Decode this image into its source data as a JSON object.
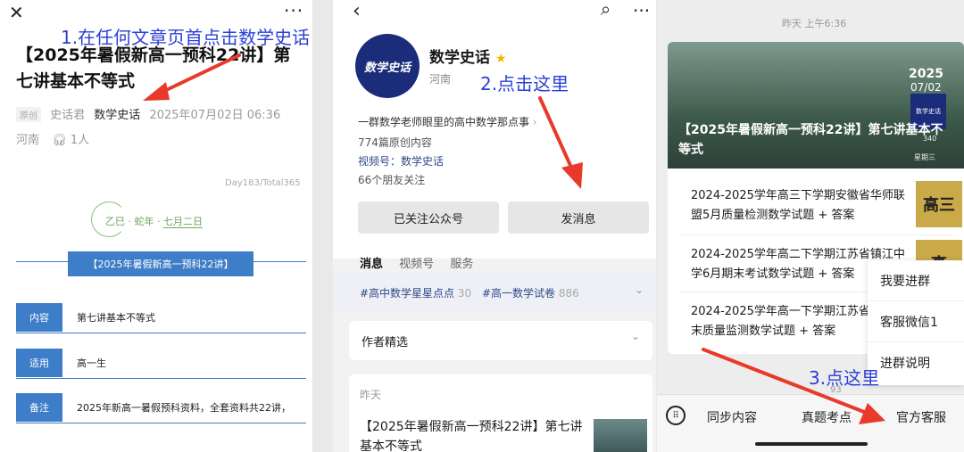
{
  "annotations": {
    "step1": "1.在任何文章页首点击数学史话",
    "step2": "2.点击这里",
    "step3": "3.点这里"
  },
  "panel1": {
    "close_icon": "close-icon",
    "more_icon": "more-dots-icon",
    "title": "【2025年暑假新高一预科22讲】第七讲基本不等式",
    "original_badge": "原创",
    "author": "史话君",
    "account": "数学史话",
    "date": "2025年07月02日 06:36",
    "location": "河南",
    "listen_count": "1人",
    "day_counter": "Day183/Total365",
    "lunar_year": "乙巳",
    "zodiac": "蛇年",
    "lunar_date": "七月二日",
    "banner": "【2025年暑假新高一预科22讲】",
    "rows": [
      {
        "label": "内容",
        "text": "第七讲基本不等式"
      },
      {
        "label": "适用",
        "text": "高一生"
      },
      {
        "label": "备注",
        "text": "2025年新高一暑假预科资料，全套资料共22讲，"
      }
    ]
  },
  "panel2": {
    "avatar_text": "数学史话",
    "name": "数学史话",
    "region": "河南",
    "bio": "一群数学老师眼里的高中数学那点事",
    "original_count": "774篇原创内容",
    "video_label": "视频号：",
    "video_name": "数学史话",
    "friends": "66个朋友关注",
    "followed_btn": "已关注公众号",
    "message_btn": "发消息",
    "tabs": [
      "消息",
      "视频号",
      "服务"
    ],
    "tags": [
      {
        "name": "#高中数学星星点点",
        "count": "30"
      },
      {
        "name": "#高一数学试卷",
        "count": "886"
      }
    ],
    "featured": "作者精选",
    "yesterday": "昨天",
    "article_title": "【2025年暑假新高一预科22讲】第七讲基本不等式"
  },
  "panel3": {
    "timestamp": "昨天 上午6:36",
    "hero_year": "2025",
    "hero_date": "07/02",
    "hero_num": "340",
    "hero_weekday": "星期三",
    "hero_logo": "数学史话",
    "hero_title": "【2025年暑假新高一预科22讲】第七讲基本不等式",
    "articles": [
      {
        "title": "2024-2025学年高三下学期安徽省华师联盟5月质量检测数学试题 + 答案",
        "thumb": "高三"
      },
      {
        "title": "2024-2025学年高二下学期江苏省镇江中学6月期末考试数学试题 + 答案",
        "thumb": "高"
      },
      {
        "title": "2024-2025学年高一下学期江苏省市6月期末质量监测数学试题 + 答案",
        "thumb": ""
      }
    ],
    "popup": [
      "我要进群",
      "客服微信1",
      "进群说明"
    ],
    "bottom_num": "93",
    "tabbar": [
      "同步内容",
      "真题考点",
      "官方客服"
    ]
  }
}
